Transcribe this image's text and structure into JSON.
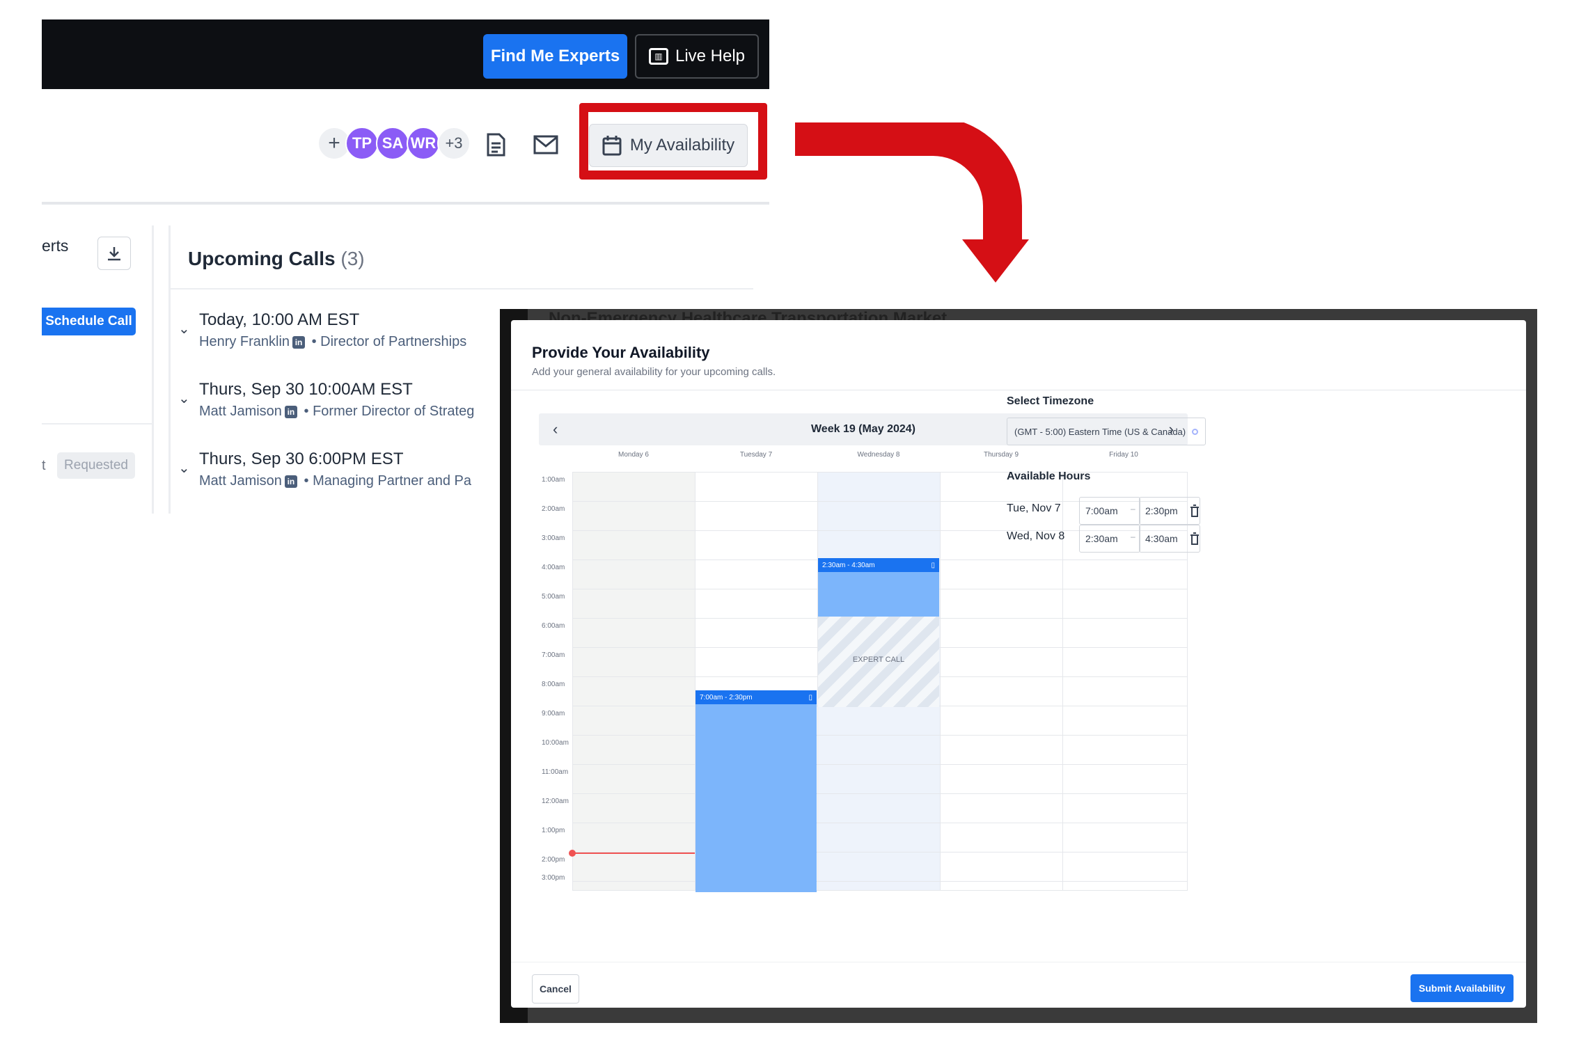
{
  "topbar": {
    "find_experts": "Find Me Experts",
    "live_help": "Live Help"
  },
  "toolbar": {
    "add": "+",
    "avatars": [
      {
        "initials": "TP",
        "color": "#8b5cf6"
      },
      {
        "initials": "SA",
        "color": "#8b5cf6"
      },
      {
        "initials": "WR",
        "color": "#8b5cf6"
      }
    ],
    "more_count": "+3",
    "availability_label": "My Availability"
  },
  "left_panel": {
    "experts_tab": "erts",
    "schedule_call": "Schedule Call",
    "t_letter": "t",
    "requested": "Requested"
  },
  "upcoming": {
    "title": "Upcoming Calls",
    "count": "(3)",
    "calls": [
      {
        "time": "Today, 10:00 AM EST",
        "name": "Henry Franklin",
        "role": "Director of Partnerships"
      },
      {
        "time": "Thurs, Sep 30 10:00AM EST",
        "name": "Matt Jamison",
        "role": "Former Director of Strateg"
      },
      {
        "time": "Thurs, Sep 30 6:00PM EST",
        "name": "Matt Jamison",
        "role": "Managing Partner and Pa"
      }
    ]
  },
  "background_title": "Non-Emergency Healthcare Transportation Market",
  "modal": {
    "title": "Provide Your Availability",
    "subtitle": "Add your general availability for your upcoming calls.",
    "week_label": "Week 19 (May 2024)",
    "days": [
      "Monday 6",
      "Tuesday 7",
      "Wednesday 8",
      "Thursday 9",
      "Friday 10"
    ],
    "times": [
      "1:00am",
      "2:00am",
      "3:00am",
      "4:00am",
      "5:00am",
      "6:00am",
      "7:00am",
      "8:00am",
      "9:00am",
      "10:00am",
      "11:00am",
      "12:00am",
      "1:00pm",
      "2:00pm",
      "3:00pm"
    ],
    "blocks": [
      {
        "label": "7:00am - 2:30pm",
        "day": "Tuesday 7"
      },
      {
        "label": "2:30am - 4:30am",
        "day": "Wednesday 8"
      }
    ],
    "expert_call": "EXPERT CALL",
    "timezone_label": "Select Timezone",
    "timezone_value": "(GMT - 5:00) Eastern Time (US & Canada)",
    "hours_label": "Available Hours",
    "hours": [
      {
        "day": "Tue, Nov 7",
        "start": "7:00am",
        "end": "2:30pm"
      },
      {
        "day": "Wed, Nov 8",
        "start": "2:30am",
        "end": "4:30am"
      }
    ],
    "cancel": "Cancel",
    "submit": "Submit Availability"
  },
  "colors": {
    "accent": "#1a73f0",
    "highlight": "#d50f15",
    "avatar": "#8b5cf6",
    "block": "#7cb5fb"
  }
}
